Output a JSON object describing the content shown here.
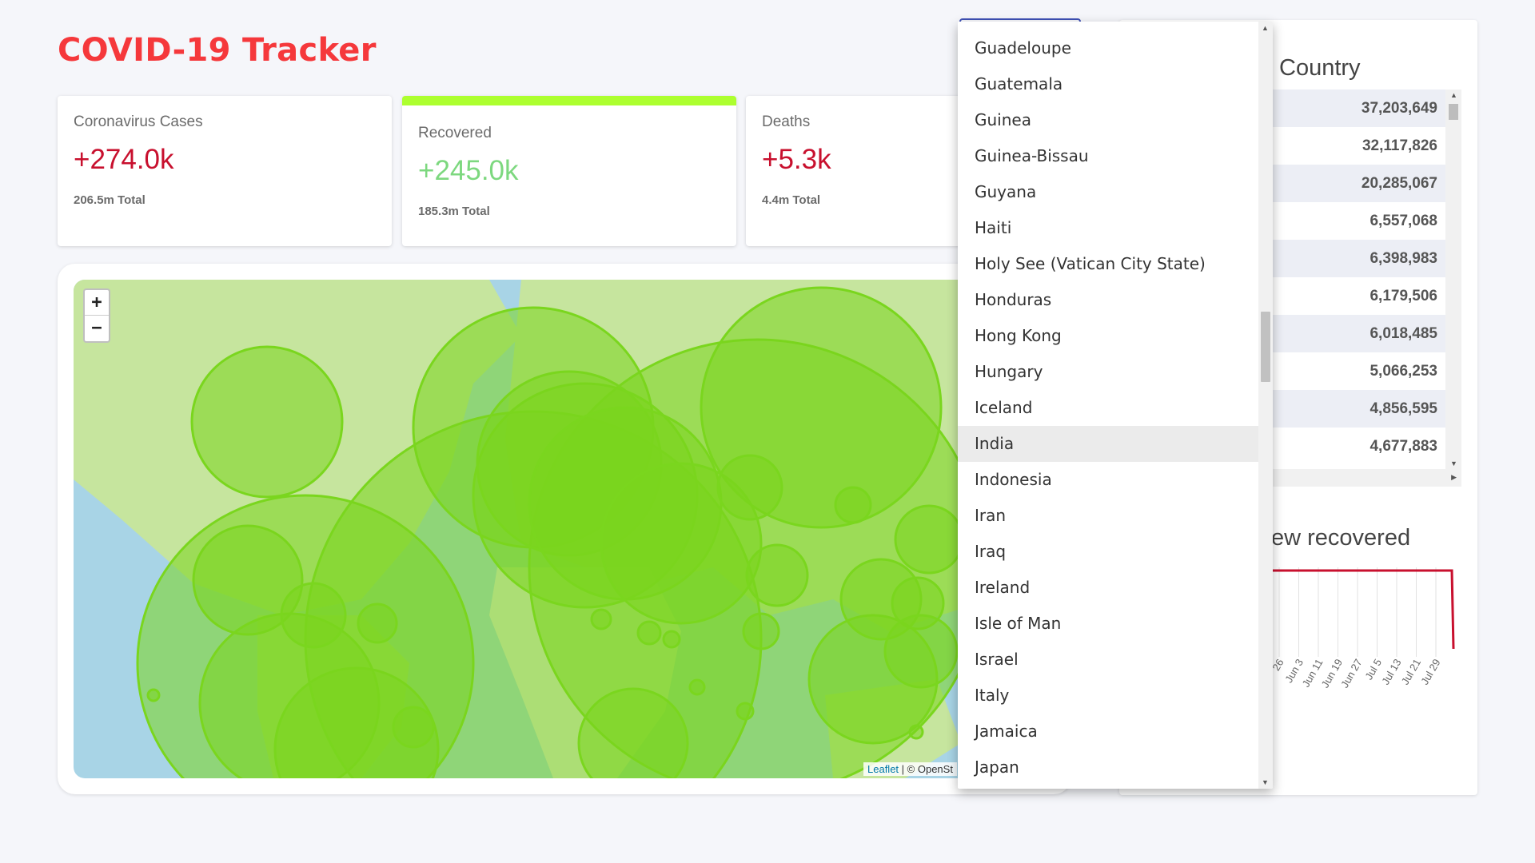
{
  "app": {
    "title": "COVID-19 Tracker"
  },
  "cards": [
    {
      "title": "Coronavirus Cases",
      "value": "+274.0k",
      "total": "206.5m Total"
    },
    {
      "title": "Recovered",
      "value": "+245.0k",
      "total": "185.3m Total"
    },
    {
      "title": "Deaths",
      "value": "+5.3k",
      "total": "4.4m Total"
    }
  ],
  "map": {
    "zoom_in": "+",
    "zoom_out": "−",
    "attribution_link": "Leaflet",
    "attribution_rest": "| © OpenSt"
  },
  "table": {
    "title": "Country",
    "rows": [
      "37,203,649",
      "32,117,826",
      "20,285,067",
      "6,557,068",
      "6,398,983",
      "6,179,506",
      "6,018,485",
      "5,066,253",
      "4,856,595",
      "4,677,883"
    ]
  },
  "chart": {
    "title": "ew recovered",
    "x_ticks": [
      "26",
      "Jun 3",
      "Jun 11",
      "Jun 19",
      "Jun 27",
      "Jul 5",
      "Jul 13",
      "Jul 21",
      "Jul 29"
    ],
    "line_color": "#c8102e"
  },
  "dropdown": {
    "items": [
      "Guadeloupe",
      "Guatemala",
      "Guinea",
      "Guinea-Bissau",
      "Guyana",
      "Haiti",
      "Holy See (Vatican City State)",
      "Honduras",
      "Hong Kong",
      "Hungary",
      "Iceland",
      "India",
      "Indonesia",
      "Iran",
      "Iraq",
      "Ireland",
      "Isle of Man",
      "Israel",
      "Italy",
      "Jamaica",
      "Japan"
    ],
    "highlighted": "India"
  }
}
